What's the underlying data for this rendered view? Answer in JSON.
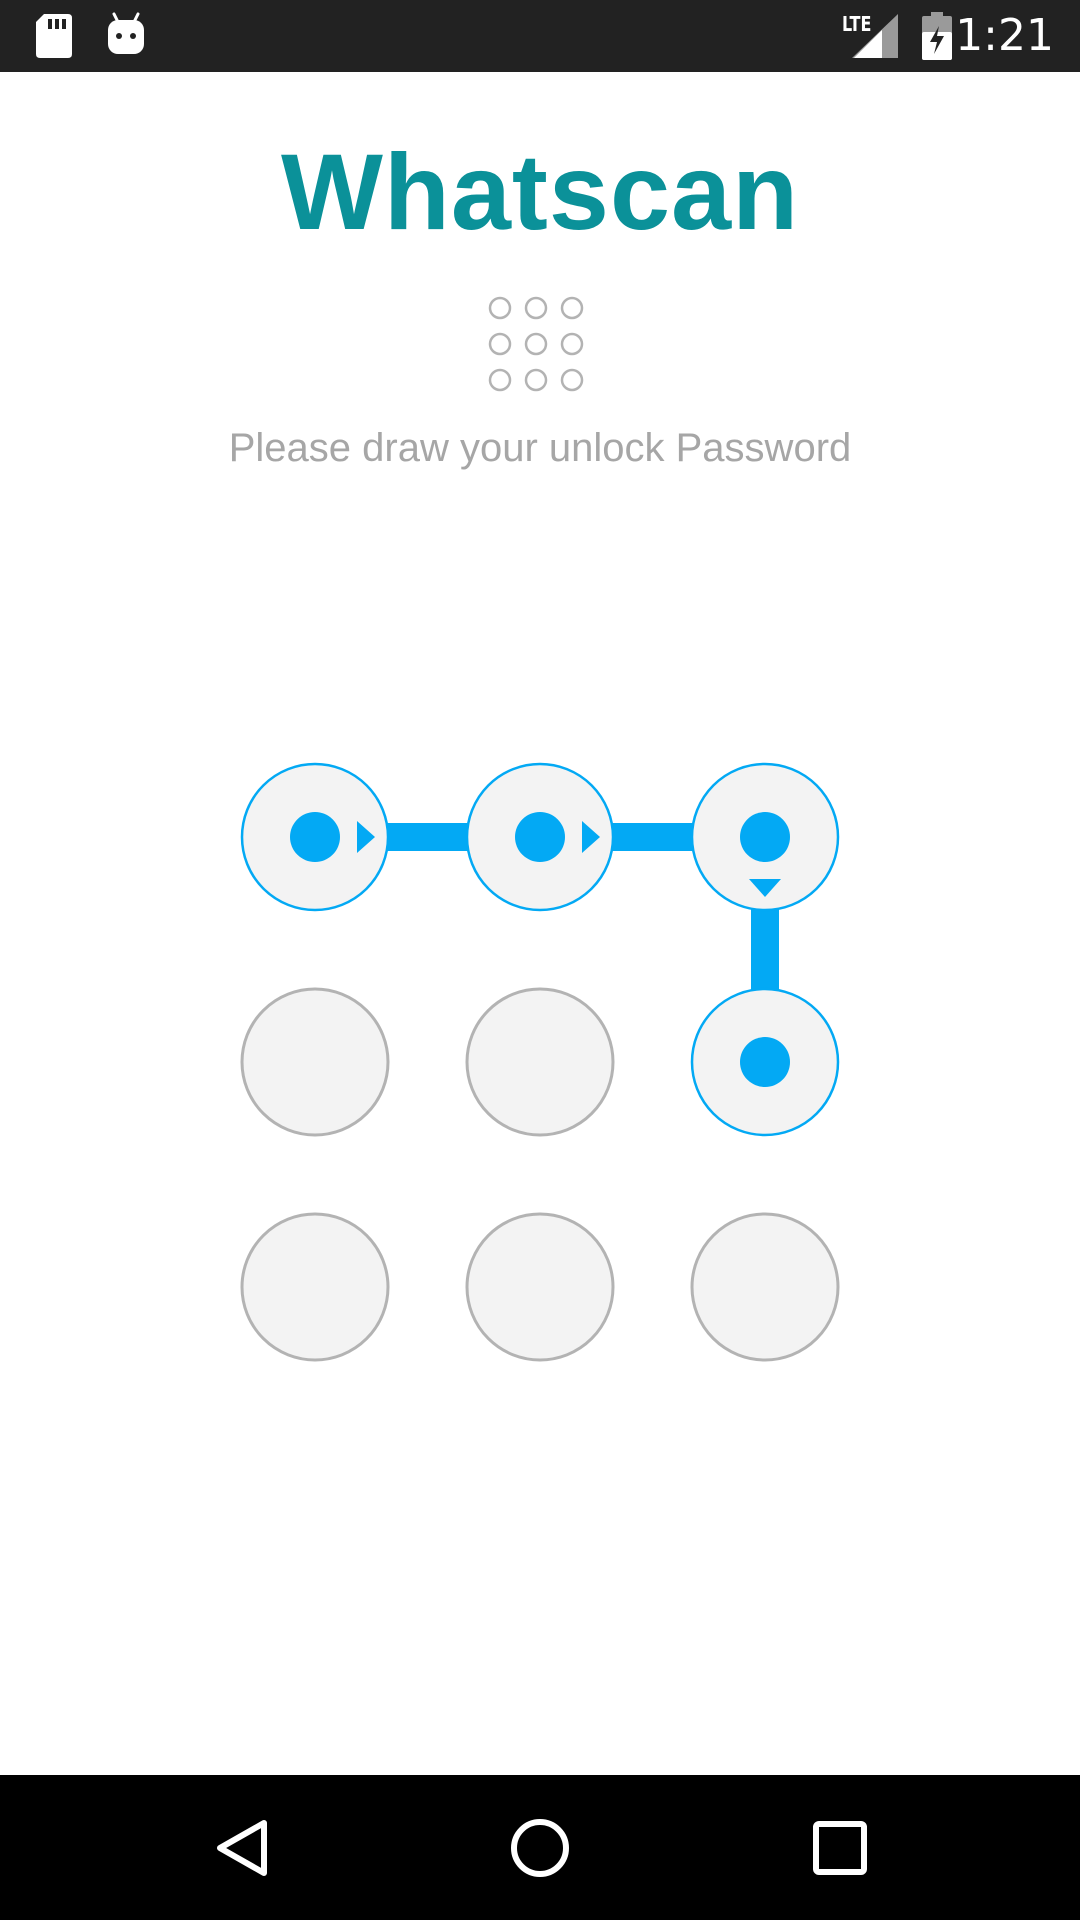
{
  "status_bar": {
    "time": "1:21",
    "network_label": "LTE",
    "left_icons": [
      "sd-card-icon",
      "android-robot-icon"
    ],
    "right_icons": [
      "lte-signal-icon",
      "battery-charging-icon"
    ]
  },
  "app": {
    "title": "Whatscan",
    "instruction": "Please draw your unlock Password",
    "header_icon": "pattern-grid-icon"
  },
  "pattern": {
    "selected_path": [
      0,
      1,
      2,
      5
    ],
    "accent_color": "#03A9F4",
    "inactive_color": "#F3F3F3",
    "inactive_border": "#B3B3B3"
  },
  "nav_bar": {
    "buttons": [
      "back-icon",
      "home-icon",
      "recents-icon"
    ]
  },
  "colors": {
    "title": "#0B9199",
    "instruction": "#A6A6A6",
    "status_bar_bg": "#222222",
    "nav_bar_bg": "#000000"
  }
}
